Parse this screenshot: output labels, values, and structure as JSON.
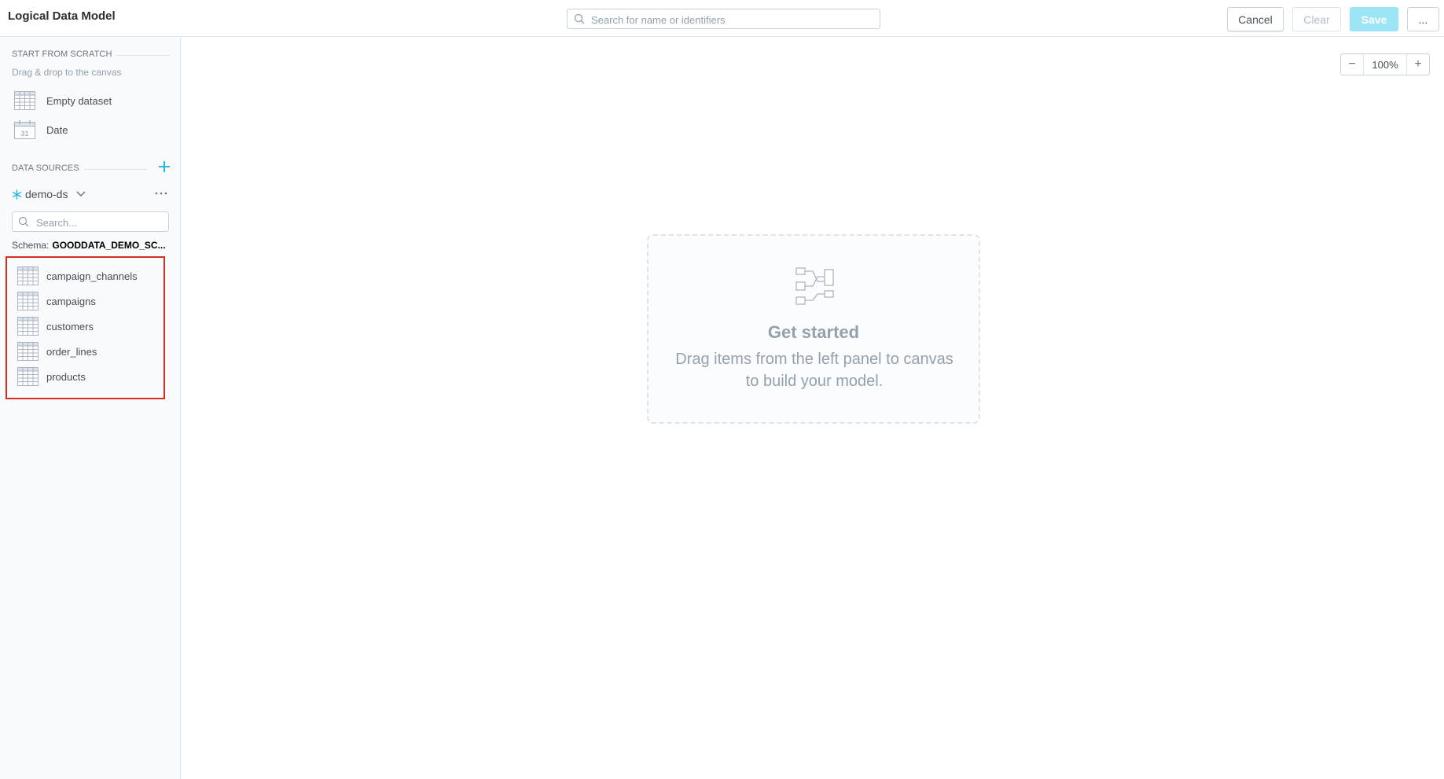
{
  "header": {
    "title": "Logical Data Model",
    "search_placeholder": "Search for name or identifiers",
    "cancel_label": "Cancel",
    "clear_label": "Clear",
    "save_label": "Save",
    "more_label": "..."
  },
  "sidebar": {
    "start_title": "START FROM SCRATCH",
    "start_hint": "Drag & drop to the canvas",
    "scratch_items": [
      {
        "label": "Empty dataset",
        "icon": "table-icon"
      },
      {
        "label": "Date",
        "icon": "calendar-icon",
        "icon_text": "31"
      }
    ],
    "data_sources_title": "DATA SOURCES",
    "data_source_name": "demo-ds",
    "search_placeholder": "Search...",
    "schema_label": "Schema:",
    "schema_value": "GOODDATA_DEMO_SC...",
    "tables": [
      {
        "label": "campaign_channels"
      },
      {
        "label": "campaigns"
      },
      {
        "label": "customers"
      },
      {
        "label": "order_lines"
      },
      {
        "label": "products"
      }
    ]
  },
  "canvas": {
    "zoom_minus": "−",
    "zoom_value": "100%",
    "zoom_plus": "+",
    "empty_title": "Get started",
    "empty_desc": "Drag items from the left panel to canvas to build your model."
  },
  "colors": {
    "accent": "#14b2e2",
    "save_disabled": "#9be5f6",
    "highlight": "#d62d1f",
    "snowflake": "#29b5e8"
  }
}
